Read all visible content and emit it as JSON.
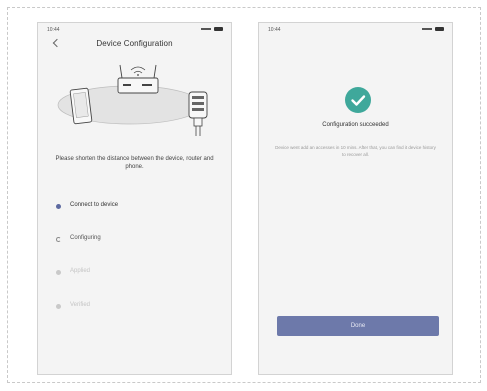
{
  "left_screen": {
    "status_time": "10:44",
    "title": "Device Configuration",
    "instruction": "Please shorten the distance between the device, router and phone.",
    "steps": [
      {
        "label": "Connect to device",
        "state": "active"
      },
      {
        "label": "Configuring",
        "state": "loading"
      },
      {
        "label": "Applied",
        "state": "pending"
      },
      {
        "label": "Verified",
        "state": "pending"
      }
    ]
  },
  "right_screen": {
    "status_time": "10:44",
    "success_title": "Configuration succeeded",
    "success_message": "Device went add an accesses in 10 mins. After that, you can find it device history to recover all.",
    "done_button_label": "Done"
  },
  "colors": {
    "accent": "#6d79aa",
    "success": "#3fa89b",
    "active_step": "#5d6aa0"
  }
}
